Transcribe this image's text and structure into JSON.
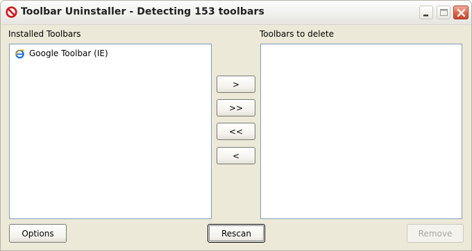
{
  "window": {
    "title": "Toolbar Uninstaller - Detecting 153 toolbars",
    "icon": "no-entry-icon",
    "controls": [
      "minimize",
      "maximize",
      "close"
    ]
  },
  "installed": {
    "label": "Installed Toolbars",
    "items": [
      {
        "label": "Google Toolbar (IE)",
        "icon": "internet-explorer-icon"
      }
    ]
  },
  "to_delete": {
    "label": "Toolbars to delete",
    "items": []
  },
  "transfer": {
    "move_one": ">",
    "move_all": ">>",
    "remove_all": "<<",
    "remove_one": "<"
  },
  "footer": {
    "options_label": "Options",
    "rescan_label": "Rescan",
    "remove_label": "Remove",
    "remove_enabled": false
  },
  "colors": {
    "dialog_bg": "#ece9d8",
    "list_border": "#7f9db9",
    "close_button": "#d65b3c",
    "disabled_text": "#a9a7a0"
  }
}
